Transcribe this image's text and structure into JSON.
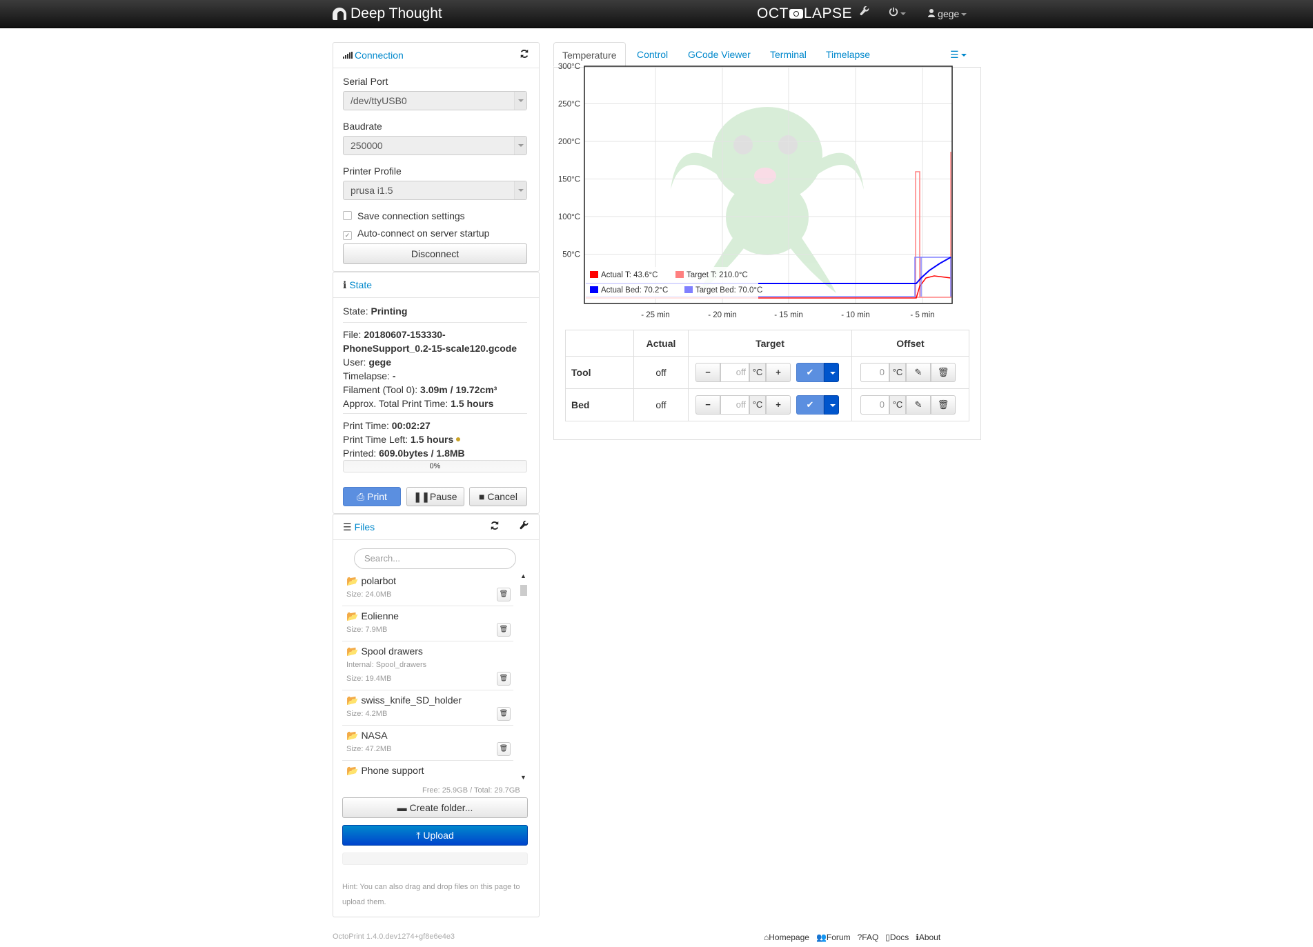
{
  "navbar": {
    "brand": "Deep Thought",
    "plugin": [
      "OCT",
      "LAPSE"
    ],
    "user": "gege"
  },
  "connection": {
    "title": "Connection",
    "serial_port_label": "Serial Port",
    "serial_port": "/dev/ttyUSB0",
    "baudrate_label": "Baudrate",
    "baudrate": "250000",
    "profile_label": "Printer Profile",
    "profile": "prusa i1.5",
    "save_settings": "Save connection settings",
    "autoconnect": "Auto-connect on server startup",
    "disconnect": "Disconnect"
  },
  "state": {
    "title": "State",
    "state_label": "State:",
    "state_value": "Printing",
    "file_label": "File:",
    "file_value_1": "20180607-153330-",
    "file_value_2": "PhoneSupport_0.2-15-scale120.gcode",
    "user_label": "User:",
    "user_value": "gege",
    "timelapse_label": "Timelapse:",
    "timelapse_value": "-",
    "filament_label": "Filament (Tool 0):",
    "filament_value": "3.09m / 19.72cm³",
    "total_time_label": "Approx. Total Print Time:",
    "total_time_value": "1.5 hours",
    "print_time_label": "Print Time:",
    "print_time_value": "00:02:27",
    "time_left_label": "Print Time Left:",
    "time_left_value": "1.5 hours",
    "printed_label": "Printed:",
    "printed_value": "609.0bytes / 1.8MB",
    "progress_text": "0%",
    "progress_fraction": 0,
    "print": "Print",
    "pause": "Pause",
    "cancel": "Cancel"
  },
  "files": {
    "title": "Files",
    "search_placeholder": "Search...",
    "items": [
      {
        "name": "polarbot",
        "size": "Size: 24.0MB"
      },
      {
        "name": "Eolienne",
        "size": "Size: 7.9MB"
      },
      {
        "name": "Spool drawers",
        "internal": "Internal: Spool_drawers",
        "size": "Size: 19.4MB"
      },
      {
        "name": "swiss_knife_SD_holder",
        "size": "Size: 4.2MB"
      },
      {
        "name": "NASA",
        "size": "Size: 47.2MB"
      },
      {
        "name": "Phone support",
        "size": ""
      }
    ],
    "storage": "Free: 25.9GB / Total: 29.7GB",
    "create_folder": "Create folder...",
    "upload": "Upload",
    "hint": "Hint: You can also drag and drop files on this page to upload them."
  },
  "tabs": [
    "Temperature",
    "Control",
    "GCode Viewer",
    "Terminal",
    "Timelapse"
  ],
  "chart_data": {
    "type": "line",
    "ylim": [
      0,
      300
    ],
    "y_ticks": [
      "300°C",
      "250°C",
      "200°C",
      "150°C",
      "100°C",
      "50°C"
    ],
    "x_ticks": [
      "- 25 min",
      "- 20 min",
      "- 15 min",
      "- 10 min",
      "- 5 min"
    ],
    "legend_placement": "bottom-left",
    "series": [
      {
        "name": "Actual T: 43.6°C",
        "color": "#ff0000"
      },
      {
        "name": "Target T: 210.0°C",
        "color": "#ff8080"
      },
      {
        "name": "Actual Bed: 70.2°C",
        "color": "#0000ff"
      },
      {
        "name": "Target Bed: 70.0°C",
        "color": "#8080ff"
      }
    ]
  },
  "temperature_table": {
    "headers": [
      "",
      "Actual",
      "Target",
      "Offset"
    ],
    "rows": [
      {
        "name": "Tool",
        "actual": "off",
        "target_placeholder": "off",
        "unit": "°C",
        "offset": "0"
      },
      {
        "name": "Bed",
        "actual": "off",
        "target_placeholder": "off",
        "unit": "°C",
        "offset": "0"
      }
    ]
  },
  "footer": {
    "version": "OctoPrint 1.4.0.dev1274+gf8e6e4e3",
    "links": [
      "Homepage",
      "Forum",
      "FAQ",
      "Docs",
      "About"
    ]
  }
}
